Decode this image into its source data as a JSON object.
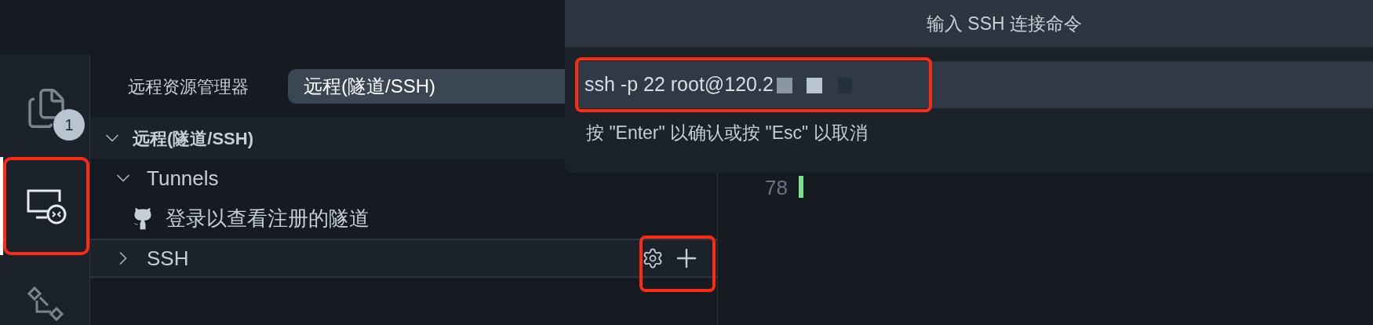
{
  "activity_bar": {
    "items": [
      {
        "kind": "files",
        "selected": false,
        "badge": "1"
      },
      {
        "kind": "remote",
        "selected": true
      },
      {
        "kind": "graph",
        "selected": false
      }
    ]
  },
  "sidebar": {
    "title": "远程资源管理器",
    "dropdown": "远程(隧道/SSH)",
    "section": {
      "label": "远程(隧道/SSH)",
      "expanded": true
    },
    "tree": [
      {
        "label": "Tunnels",
        "expanded": true,
        "children": [
          {
            "label": "登录以查看注册的隧道",
            "kind": "github"
          }
        ]
      },
      {
        "label": "SSH",
        "expanded": false,
        "hovered": true
      }
    ]
  },
  "editor": {
    "line_number": "78"
  },
  "quick_input": {
    "title": "输入 SSH 连接命令",
    "value": "ssh -p 22 root@120.2",
    "hint": "按 \"Enter\" 以确认或按 \"Esc\" 以取消"
  }
}
